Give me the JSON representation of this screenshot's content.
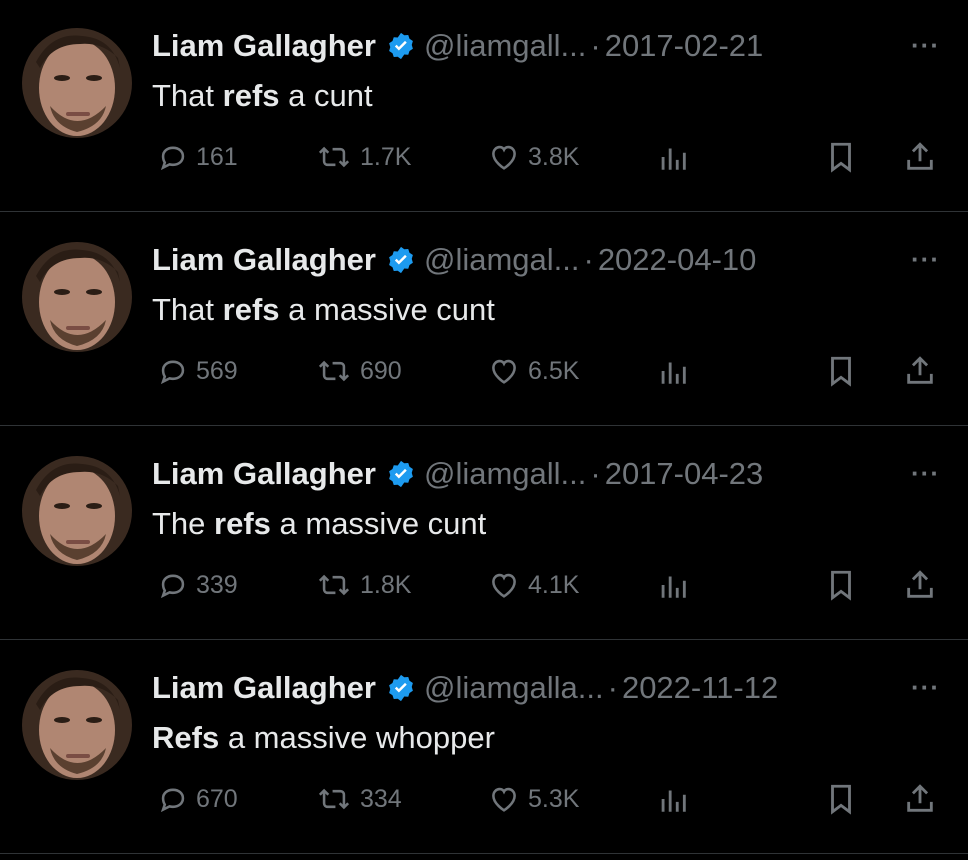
{
  "tweets": [
    {
      "name": "Liam Gallagher",
      "handle": "@liamgall...",
      "date": "2017-02-21",
      "text_pre": "That ",
      "text_bold": "refs",
      "text_post": " a cunt",
      "replies": "161",
      "retweets": "1.7K",
      "likes": "3.8K"
    },
    {
      "name": "Liam Gallagher",
      "handle": "@liamgal...",
      "date": "2022-04-10",
      "text_pre": "That ",
      "text_bold": "refs",
      "text_post": " a massive cunt",
      "replies": "569",
      "retweets": "690",
      "likes": "6.5K"
    },
    {
      "name": "Liam Gallagher",
      "handle": "@liamgall...",
      "date": "2017-04-23",
      "text_pre": "The ",
      "text_bold": "refs",
      "text_post": " a massive cunt",
      "replies": "339",
      "retweets": "1.8K",
      "likes": "4.1K"
    },
    {
      "name": "Liam Gallagher",
      "handle": "@liamgalla...",
      "date": "2022-11-12",
      "text_pre": "",
      "text_bold": "Refs",
      "text_post": " a massive whopper",
      "replies": "670",
      "retweets": "334",
      "likes": "5.3K"
    }
  ],
  "separator": "·",
  "more_label": "···",
  "icons": {
    "reply": "reply-icon",
    "retweet": "retweet-icon",
    "like": "heart-icon",
    "views": "analytics-icon",
    "bookmark": "bookmark-icon",
    "share": "share-icon",
    "verified": "verified-badge-icon"
  },
  "colors": {
    "background": "#000000",
    "text": "#e7e9ea",
    "muted": "#71767b",
    "verified": "#1d9bf0",
    "divider": "#2f3336"
  }
}
